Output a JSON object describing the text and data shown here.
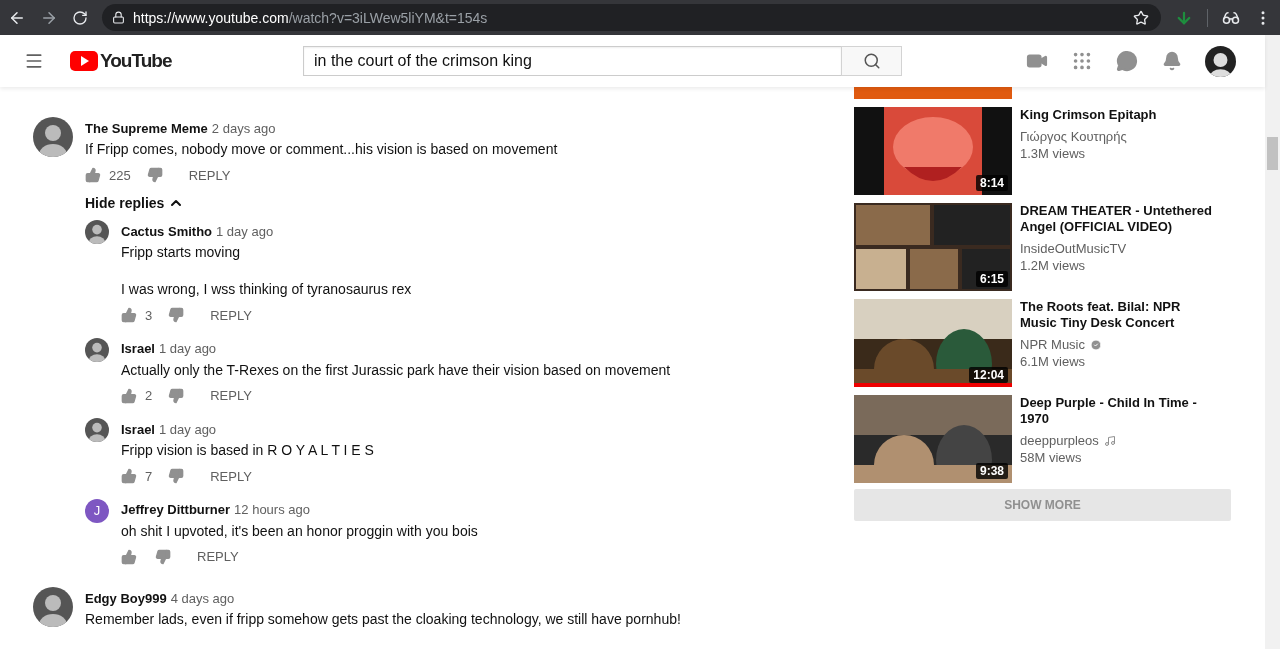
{
  "browser": {
    "url_host": "https://www.youtube.com",
    "url_path": "/watch?v=3iLWew5liYM&t=154s"
  },
  "header": {
    "logo": "YouTube",
    "search": {
      "value": "in the court of the crimson king"
    }
  },
  "comments": [
    {
      "author": "The Supreme Meme",
      "time": "2 days ago",
      "text": [
        "If Fripp comes, nobody move or comment...his vision is based on movement"
      ],
      "likes": "225",
      "reply_label": "REPLY",
      "avatar": {
        "kind": "picture"
      },
      "replies_toggle": "Hide replies",
      "replies": [
        {
          "author": "Cactus Smitho",
          "time": "1 day ago",
          "text": [
            "Fripp starts moving",
            "I was wrong, I wss thinking of tyranosaurus rex"
          ],
          "likes": "3",
          "reply_label": "REPLY",
          "avatar": {
            "kind": "picture"
          }
        },
        {
          "author": "Israel",
          "time": "1 day ago",
          "text": [
            "Actually only the T-Rexes on the first Jurassic park have their vision based on movement"
          ],
          "likes": "2",
          "reply_label": "REPLY",
          "avatar": {
            "kind": "picture"
          }
        },
        {
          "author": "Israel",
          "time": "1 day ago",
          "text": [
            "Fripp vision is based in R O Y A L T I E S"
          ],
          "likes": "7",
          "reply_label": "REPLY",
          "avatar": {
            "kind": "picture"
          }
        },
        {
          "author": "Jeffrey Dittburner",
          "time": "12 hours ago",
          "text": [
            "oh shit I upvoted, it's been an honor proggin with you bois"
          ],
          "reply_label": "REPLY",
          "avatar": {
            "kind": "letter",
            "letter": "J",
            "color": "#7e57c2"
          }
        }
      ]
    },
    {
      "author": "Edgy Boy999",
      "time": "4 days ago",
      "text": [
        "Remember lads, even if fripp somehow gets past the cloaking technology, we still have pornhub!"
      ],
      "avatar": {
        "kind": "picture"
      }
    }
  ],
  "related": [
    {
      "kind": "partial"
    },
    {
      "kind": "video",
      "title": "King Crimson Epitaph",
      "channel": "Γιώργος Κουτηρής",
      "views": "1.3M views",
      "duration": "8:14",
      "verified": false,
      "music_note": false
    },
    {
      "kind": "video",
      "title": "DREAM THEATER - Untethered Angel (OFFICIAL VIDEO)",
      "channel": "InsideOutMusicTV",
      "views": "1.2M views",
      "duration": "6:15",
      "verified": false,
      "music_note": false
    },
    {
      "kind": "video",
      "title": "The Roots feat. Bilal: NPR Music Tiny Desk Concert",
      "channel": "NPR Music",
      "verified": true,
      "music_note": false,
      "views": "6.1M views",
      "duration": "12:04",
      "watched": {
        "level": 1
      }
    },
    {
      "kind": "video",
      "title": "Deep Purple - Child In Time - 1970",
      "channel": "deeppurpleos",
      "verified": false,
      "music_note": true,
      "views": "58M views",
      "duration": "9:38"
    }
  ],
  "show_more": "SHOW MORE"
}
